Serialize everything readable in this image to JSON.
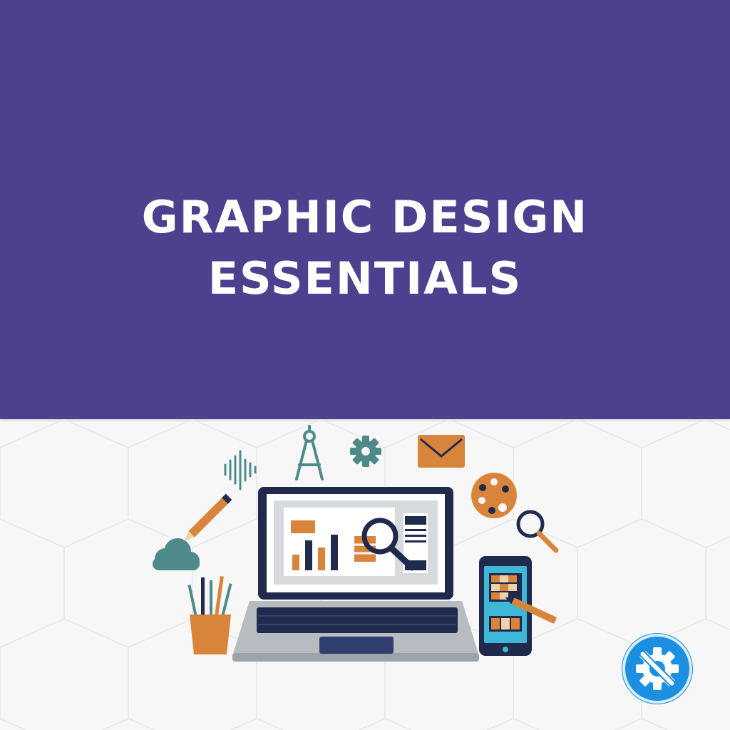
{
  "title": {
    "line1": "GRAPHIC DESIGN",
    "line2": "ESSENTIALS"
  },
  "colors": {
    "banner": "#4b418e",
    "background": "#f7f7f8",
    "navy": "#1f2a4d",
    "teal": "#4f8a8b",
    "orange": "#d9843b",
    "badge": "#1b8fe0"
  },
  "illustration": {
    "icons": [
      "sound-wave-icon",
      "compass-icon",
      "gear-icon",
      "envelope-icon",
      "pencil-icon",
      "cloud-icon",
      "palette-icon",
      "magnifier-icon",
      "pencil-cup-icon",
      "laptop-icon",
      "smartphone-icon",
      "stylus-icon"
    ]
  },
  "badge": {
    "icon": "settings-gear-wrench-icon"
  }
}
